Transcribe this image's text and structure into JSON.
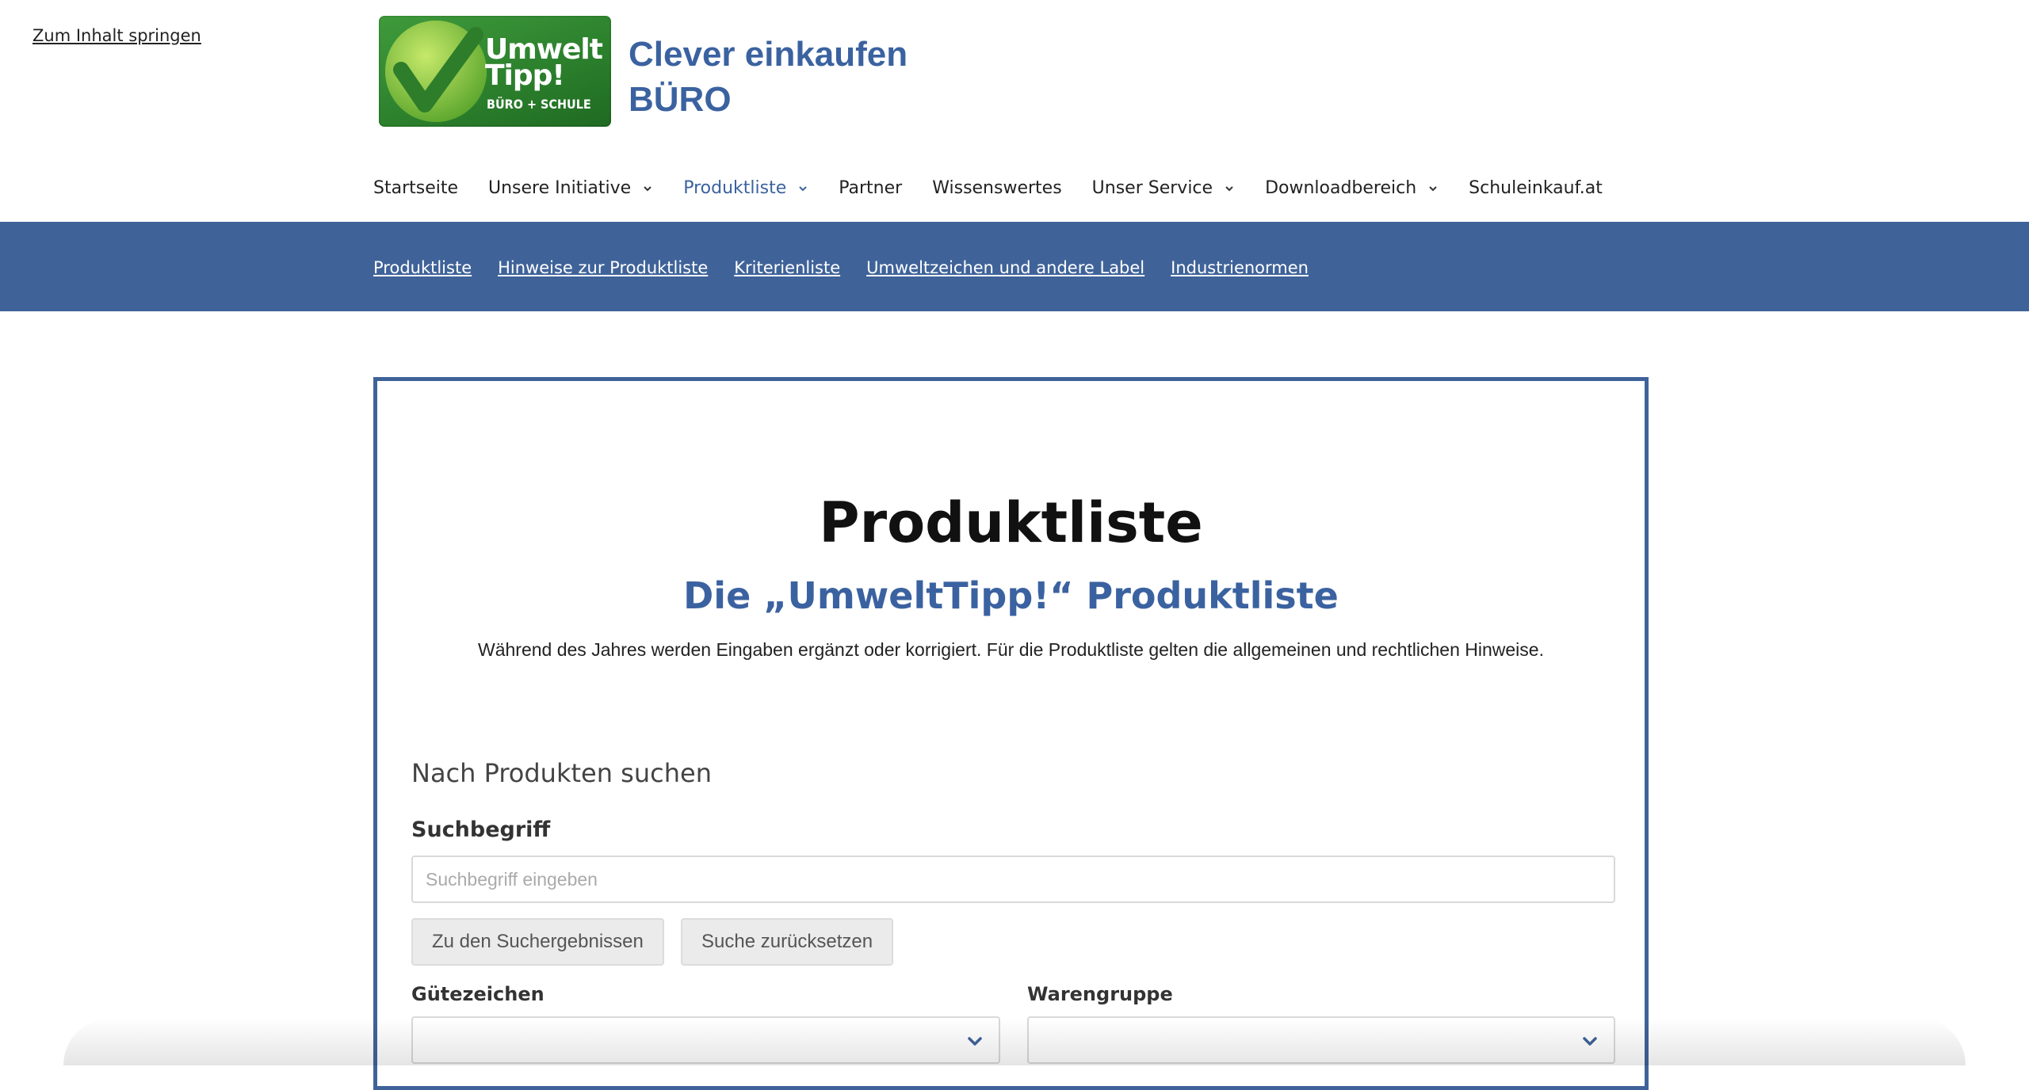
{
  "skip_link": "Zum Inhalt springen",
  "logo": {
    "line1": "Umwelt",
    "line2": "Tipp!",
    "line3": "BÜRO + SCHULE"
  },
  "site_title": {
    "line1": "Clever einkaufen",
    "line2": "BÜRO"
  },
  "main_nav": [
    {
      "label": "Startseite",
      "has_dropdown": false,
      "active": false
    },
    {
      "label": "Unsere Initiative",
      "has_dropdown": true,
      "active": false
    },
    {
      "label": "Produktliste",
      "has_dropdown": true,
      "active": true
    },
    {
      "label": "Partner",
      "has_dropdown": false,
      "active": false
    },
    {
      "label": "Wissenswertes",
      "has_dropdown": false,
      "active": false
    },
    {
      "label": "Unser Service",
      "has_dropdown": true,
      "active": false
    },
    {
      "label": "Downloadbereich",
      "has_dropdown": true,
      "active": false
    },
    {
      "label": "Schuleinkauf.at",
      "has_dropdown": false,
      "active": false
    }
  ],
  "sub_nav": [
    "Produktliste",
    "Hinweise zur Produktliste",
    "Kriterienliste",
    "Umweltzeichen und andere Label",
    "Industrienormen"
  ],
  "main": {
    "title": "Produktliste",
    "subtitle": "Die „UmweltTipp!“ Produktliste",
    "intro": "Während des Jahres werden Eingaben ergänzt oder korrigiert. Für die Produktliste gelten die allgemeinen und rechtlichen Hinweise.",
    "search_heading": "Nach Produkten suchen",
    "search_label": "Suchbegriff",
    "search_placeholder": "Suchbegriff eingeben",
    "search_value": "",
    "btn_results": "Zu den Suchergebnissen",
    "btn_reset": "Suche zurücksetzen",
    "filter1_label": "Gütezeichen",
    "filter1_value": "",
    "filter2_label": "Warengruppe",
    "filter2_value": ""
  },
  "colors": {
    "brand_blue": "#3f6399",
    "brand_green": "#2f8a31",
    "text": "#222222"
  }
}
